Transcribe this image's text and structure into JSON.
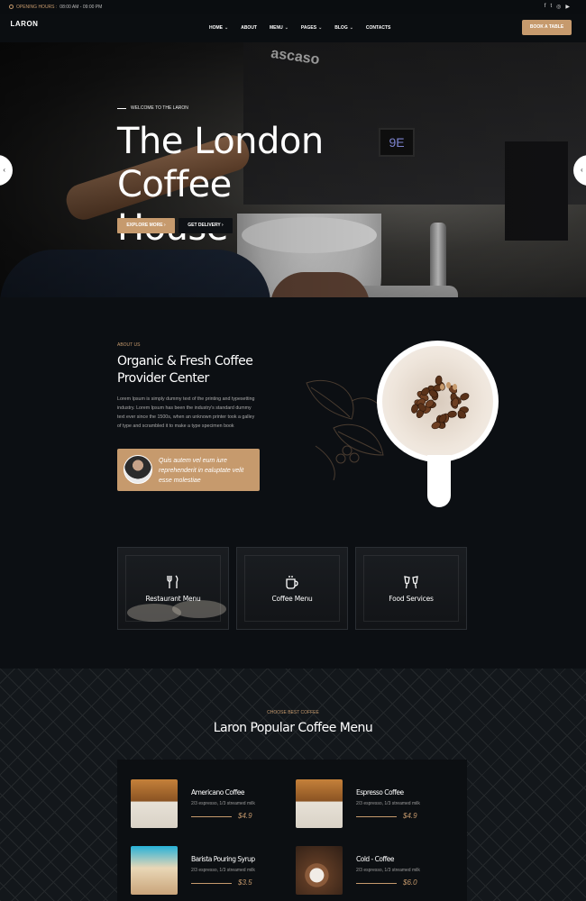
{
  "topbar": {
    "hours_label": "OPENING HOURS :",
    "hours_value": "08:00 AM - 09:00 PM",
    "social": [
      "f",
      "t",
      "◎",
      "▶"
    ]
  },
  "nav": {
    "logo_text": "LARON",
    "items": [
      {
        "label": "HOME",
        "has_dropdown": true
      },
      {
        "label": "ABOUT",
        "has_dropdown": false
      },
      {
        "label": "MENU",
        "has_dropdown": true
      },
      {
        "label": "PAGES",
        "has_dropdown": true
      },
      {
        "label": "BLOG",
        "has_dropdown": true
      },
      {
        "label": "CONTACTS",
        "has_dropdown": false
      }
    ],
    "book_button": "BOOK A TABLE"
  },
  "hero": {
    "welcome": "WELCOME TO THE LARON",
    "title_line1": "The London",
    "title_line2": "Coffee House",
    "btn_explore": "EXPLORE MORE",
    "btn_delivery": "GET DELIVERY",
    "machine_brand": "ascaso",
    "display_value": "9E"
  },
  "about": {
    "subtitle": "ABOUT US",
    "title_line1": "Organic & Fresh Coffee",
    "title_line2": "Provider Center",
    "text": "Lorem Ipsum is simply dummy text of the printing and typesetting industry. Lorem Ipsum has been the industry's standard dummy text ever since the 1500s, when an unknown printer took a galley of type and scrambled it to make a type specimen book",
    "quote": "Quis autem vel eum iure reprehenderit in ealuptate velit esse molestiae"
  },
  "services": [
    {
      "label": "Restaurant Menu",
      "icon": "cutlery-icon"
    },
    {
      "label": "Coffee Menu",
      "icon": "coffee-cup-icon"
    },
    {
      "label": "Food Services",
      "icon": "cheers-icon"
    }
  ],
  "menu_section": {
    "subtitle": "CHOOSE BEST COFFEE",
    "title": "Laron Popular Coffee Menu",
    "items": [
      {
        "name": "Americano Coffee",
        "desc": "2/3 espresso, 1/3 streamed milk",
        "price": "$4.9"
      },
      {
        "name": "Espresso Coffee",
        "desc": "2/3 espresso, 1/3 streamed milk",
        "price": "$4.9"
      },
      {
        "name": "Barista Pouring Syrup",
        "desc": "2/3 espresso, 1/3 streamed milk",
        "price": "$3.5"
      },
      {
        "name": "Cold - Coffee",
        "desc": "2/3 espresso, 1/3 streamed milk",
        "price": "$6.0"
      }
    ]
  },
  "colors": {
    "accent": "#c69a6d",
    "background": "#0c0f13"
  }
}
